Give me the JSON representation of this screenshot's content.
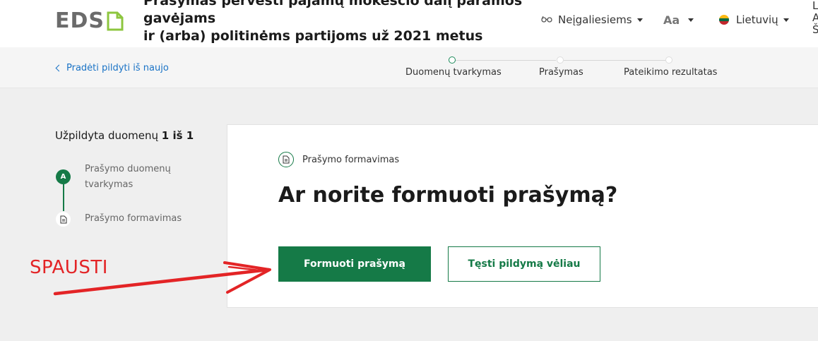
{
  "header": {
    "logo_text": "EDS",
    "title_lines": [
      "Prašymas pervesti pajamų mokesčio dalį paramos",
      "gavėjams",
      "ir (arba) politinėms partijoms už 2021 metus"
    ],
    "accessibility_label": "Neįgaliesiems",
    "accessibility_icon": "glasses-icon",
    "font_size_label": "Aa",
    "language_label": "Lietuvių",
    "edge_text": [
      "L",
      "A",
      "Š"
    ]
  },
  "progress": {
    "back_link": "Pradėti pildyti iš naujo",
    "steps": [
      {
        "label": "Duomenų tvarkymas",
        "active": true
      },
      {
        "label": "Prašymas",
        "active": false
      },
      {
        "label": "Pateikimo rezultatas",
        "active": false
      }
    ]
  },
  "sidebar": {
    "title_prefix": "Užpildyta duomenų",
    "title_count": "1 iš 1",
    "items": [
      {
        "marker": "A",
        "label_line1": "Prašymo duomenų",
        "label_line2": "tvarkymas"
      },
      {
        "marker": "document-icon",
        "label_line1": "Prašymo formavimas"
      }
    ]
  },
  "card": {
    "badge_label": "Prašymo formavimas",
    "heading": "Ar norite formuoti prašymą?",
    "primary_button": "Formuoti prašymą",
    "secondary_button": "Tęsti pildymą vėliau"
  },
  "annotation": {
    "text": "SPAUSTI",
    "color": "#e32426"
  },
  "colors": {
    "brand_green": "#157a47",
    "link_blue": "#1a73c6",
    "logo_green": "#8dc63f"
  }
}
